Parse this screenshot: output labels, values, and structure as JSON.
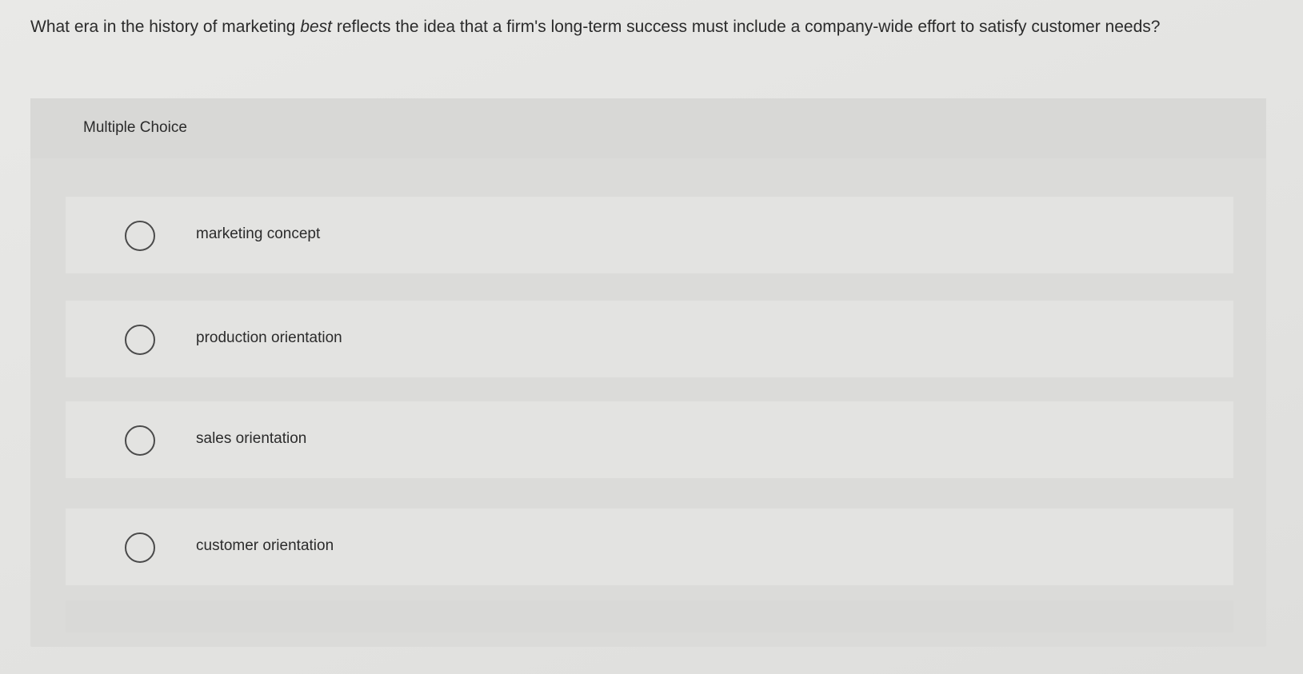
{
  "question": {
    "prefix": "What era in the history of marketing ",
    "emphasis": "best",
    "suffix": " reflects the idea that a firm's long-term success must include a company-wide effort to satisfy customer needs?"
  },
  "panel": {
    "title": "Multiple Choice"
  },
  "options": [
    {
      "label": "marketing concept",
      "selected": false
    },
    {
      "label": "production orientation",
      "selected": false
    },
    {
      "label": "sales orientation",
      "selected": false
    },
    {
      "label": "customer orientation",
      "selected": false
    }
  ]
}
